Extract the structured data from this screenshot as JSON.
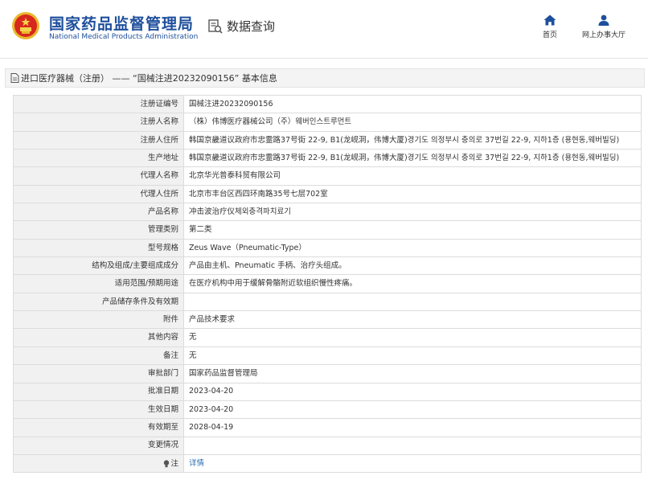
{
  "header": {
    "title_cn": "国家药品监督管理局",
    "title_en": "National Medical Products Administration",
    "query_label": "数据查询",
    "nav": [
      {
        "label": "首页"
      },
      {
        "label": "网上办事大厅"
      }
    ]
  },
  "breadcrumb": "进口医疗器械（注册） —— “国械注进20232090156” 基本信息",
  "rows": [
    {
      "label": "注册证编号",
      "value": "国械注进20232090156"
    },
    {
      "label": "注册人名称",
      "value": "（株）伟博医疗器械公司（주）웨버인스트루먼트"
    },
    {
      "label": "注册人住所",
      "value": "韩国京畿道议政府市忠霊路37号街 22-9, B1(龙岘洞，伟博大厦)경기도 의정부시 충의로 37번길 22-9, 지하1층 (용현동,웨버빌딩)"
    },
    {
      "label": "生产地址",
      "value": "韩国京畿道议政府市忠霊路37号街 22-9, B1(龙岘洞，伟博大厦)경기도 의정부시 충의로 37번길 22-9, 지하1층 (용현동,웨버빌딩)"
    },
    {
      "label": "代理人名称",
      "value": "北京华光普泰科贸有限公司"
    },
    {
      "label": "代理人住所",
      "value": "北京市丰台区西四环南路35号七层702室"
    },
    {
      "label": "产品名称",
      "value": "冲击波治疗仪체외충격파치료기"
    },
    {
      "label": "管理类别",
      "value": "第二类"
    },
    {
      "label": "型号规格",
      "value": "Zeus Wave（Pneumatic-Type）"
    },
    {
      "label": "结构及组成/主要组成成分",
      "value": "产品由主机、Pneumatic 手柄、治疗头组成。"
    },
    {
      "label": "适用范围/预期用途",
      "value": "在医疗机构中用于缓解骨骼附近软组织慢性疼痛。"
    },
    {
      "label": "产品储存条件及有效期",
      "value": ""
    },
    {
      "label": "附件",
      "value": "产品技术要求"
    },
    {
      "label": "其他内容",
      "value": "无"
    },
    {
      "label": "备注",
      "value": "无"
    },
    {
      "label": "审批部门",
      "value": "国家药品监督管理局"
    },
    {
      "label": "批准日期",
      "value": "2023-04-20"
    },
    {
      "label": "生效日期",
      "value": "2023-04-20"
    },
    {
      "label": "有效期至",
      "value": "2028-04-19"
    },
    {
      "label": "变更情况",
      "value": ""
    }
  ],
  "note_row": {
    "label": "注",
    "link": "详情"
  },
  "colors": {
    "brand_blue": "#1e4f9c",
    "logo_red": "#d7281e",
    "logo_gold": "#e9b82c",
    "link": "#2b6cb0"
  }
}
